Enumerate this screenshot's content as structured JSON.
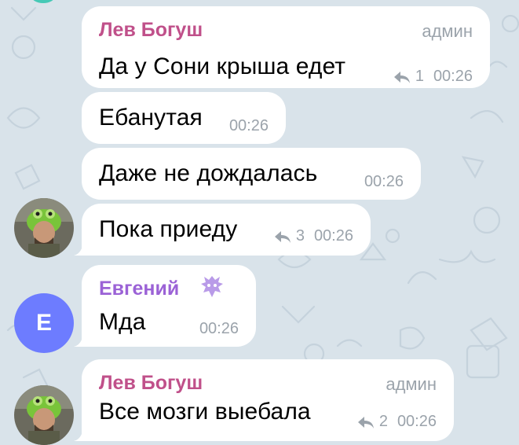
{
  "colors": {
    "background": "#d9e3ea",
    "bubble": "#ffffff",
    "name_lev": "#c0508a",
    "name_evgeniy": "#9b62d6",
    "meta_text": "#9ba3ab",
    "avatar_e": "#6d7cff"
  },
  "messages": [
    {
      "sender": "Лев Богуш",
      "role": "админ",
      "text": "Да у Сони крыша едет",
      "replies": "1",
      "time": "00:26"
    },
    {
      "text": "Ебанутая",
      "time": "00:26"
    },
    {
      "text": "Даже не дождалась",
      "time": "00:26"
    },
    {
      "text": "Пока приеду",
      "replies": "3",
      "time": "00:26"
    },
    {
      "sender": "Евгений",
      "text": "Мда",
      "time": "00:26",
      "sender_badge": "dragon-icon"
    },
    {
      "sender": "Лев Богуш",
      "role": "админ",
      "text": "Все мозги выебала",
      "replies": "2",
      "time": "00:26"
    }
  ],
  "avatars": {
    "evgeniy_letter": "Е",
    "lev_photo": "user-photo-avatar"
  }
}
